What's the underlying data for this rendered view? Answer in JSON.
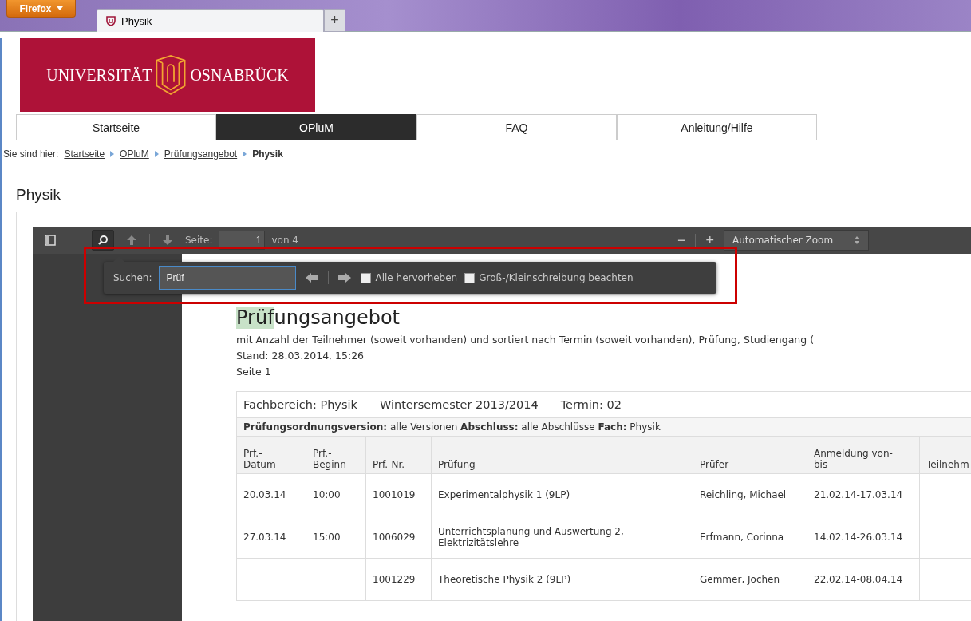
{
  "browser": {
    "menu_button": "Firefox",
    "tabs": [
      {
        "title": "Physik",
        "selected": true
      }
    ],
    "new_tab": "+"
  },
  "site": {
    "logo_left": "UNIVERSITÄT",
    "logo_right": "OSNABRÜCK",
    "nav": [
      {
        "label": "Startseite",
        "selected": false
      },
      {
        "label": "OPluM",
        "selected": true
      },
      {
        "label": "FAQ",
        "selected": false
      },
      {
        "label": "Anleitung/Hilfe",
        "selected": false
      }
    ],
    "breadcrumb": {
      "prefix": "Sie sind hier:",
      "items": [
        {
          "label": "Startseite",
          "kind": "link"
        },
        {
          "label": "OPluM",
          "kind": "link"
        },
        {
          "label": "Prüfungsangebot",
          "kind": "link"
        },
        {
          "label": "Physik",
          "kind": "current"
        }
      ]
    },
    "page_title": "Physik"
  },
  "viewer": {
    "toolbar": {
      "page_label": "Seite:",
      "page_value": "1",
      "page_total": "von 4",
      "zoom_minus": "−",
      "zoom_plus": "+",
      "zoom": "Automatischer Zoom",
      "search_selected": true
    },
    "find_bar": {
      "label": "Suchen:",
      "value": "Prüf",
      "options": [
        {
          "label": "Alle hervorheben",
          "checked": false
        },
        {
          "label": "Groß-/Kleinschreibung beachten",
          "checked": false
        }
      ]
    },
    "document": {
      "title_parts": [
        {
          "text": "Prüf",
          "highlighted": true
        },
        {
          "text": "ungsangebot",
          "highlighted": false
        }
      ],
      "lines": [
        "mit Anzahl der Teilnehmer (soweit vorhanden) und sortiert nach Termin (soweit vorhanden), Prüfung, Studiengang (",
        "Stand: 28.03.2014, 15:26",
        "Seite 1"
      ],
      "table": {
        "heading": [
          "Fachbereich: Physik",
          "Wintersemester 2013/2014",
          "Termin: 02"
        ],
        "filter": "**Prüfungsordnungsversion:** alle Versionen  **Abschluss:** alle Abschlüsse  **Fach:** Physik",
        "columns": [
          "Prf.-\nDatum",
          "Prf.-\nBeginn",
          "Prf.-Nr.",
          "Prüfung",
          "Prüfer",
          "Anmeldung von-\nbis",
          "Teilnehm"
        ],
        "rows": [
          [
            "20.03.14",
            "10:00",
            "1001019",
            "Experimentalphysik 1 (9LP)",
            "Reichling, Michael",
            "21.02.14-17.03.14",
            null
          ],
          [
            "27.03.14",
            "15:00",
            "1006029",
            "Unterrichtsplanung und Auswertung 2, Elektrizitätslehre",
            "Erfmann, Corinna",
            "14.02.14-26.03.14",
            null
          ],
          [
            null,
            null,
            "1001229",
            "Theoretische Physik 2 (9LP)",
            "Gemmer, Jochen",
            "22.02.14-08.04.14",
            null
          ]
        ]
      }
    }
  }
}
